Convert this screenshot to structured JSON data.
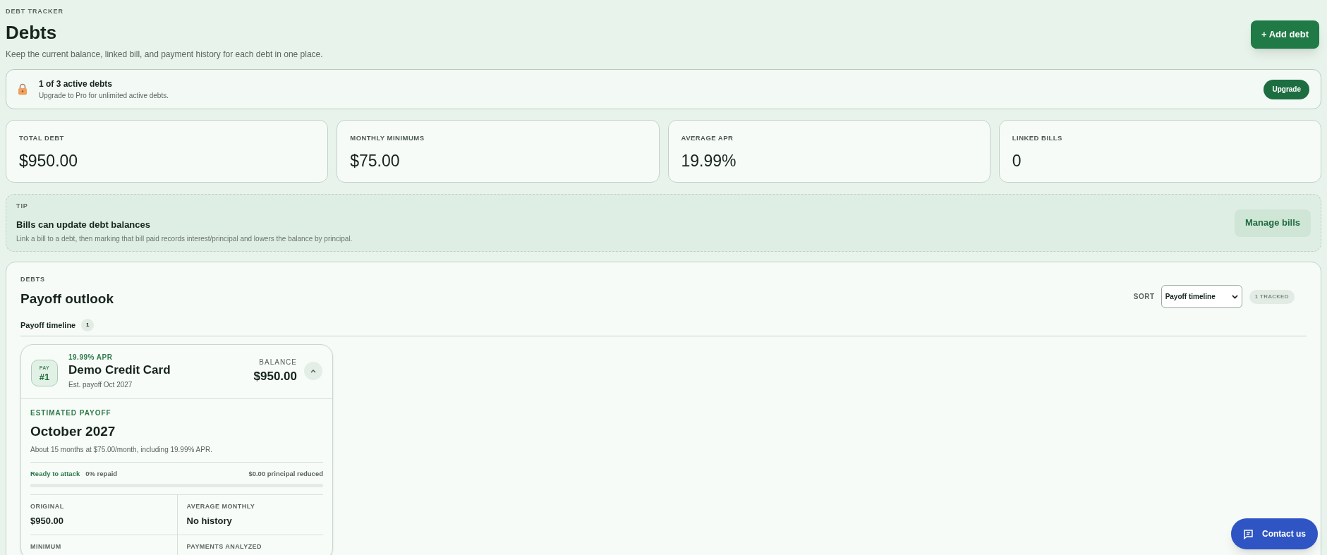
{
  "header": {
    "eyebrow": "DEBT TRACKER",
    "title": "Debts",
    "subtitle": "Keep the current balance, linked bill, and payment history for each debt in one place.",
    "add_button": "+ Add debt"
  },
  "limit_banner": {
    "title": "1 of 3 active debts",
    "text": "Upgrade to Pro for unlimited active debts.",
    "button": "Upgrade"
  },
  "stats": [
    {
      "label": "TOTAL DEBT",
      "value": "$950.00"
    },
    {
      "label": "MONTHLY MINIMUMS",
      "value": "$75.00"
    },
    {
      "label": "AVERAGE APR",
      "value": "19.99%"
    },
    {
      "label": "LINKED BILLS",
      "value": "0"
    }
  ],
  "tip": {
    "eyebrow": "TIP",
    "title": "Bills can update debt balances",
    "text": "Link a bill to a debt, then marking that bill paid records interest/principal and lowers the balance by principal.",
    "button": "Manage bills"
  },
  "debts_panel": {
    "eyebrow": "DEBTS",
    "title": "Payoff outlook",
    "sort_label": "SORT",
    "sort_value": "Payoff timeline",
    "tracked_badge": "1 TRACKED",
    "tabs": [
      {
        "label": "Payoff timeline",
        "count": "1",
        "selected": true
      }
    ],
    "cards": [
      {
        "apr": "19.99% APR",
        "rank_label": "PAY",
        "rank": "#1",
        "name": "Demo Credit Card",
        "est_payoff": "Est. payoff Oct 2027",
        "balance_label": "BALANCE",
        "balance": "$950.00",
        "expanded": true,
        "payoff_label": "ESTIMATED PAYOFF",
        "payoff_date": "October 2027",
        "payoff_text": "About 15 months at $75.00/month, including 19.99% APR.",
        "status": "Ready to attack",
        "repaid": "0% repaid",
        "reduced": "$0.00 principal reduced",
        "level": 0,
        "details": [
          {
            "label": "ORIGINAL",
            "value": "$950.00"
          },
          {
            "label": "AVERAGE MONTHLY",
            "value": "No history"
          },
          {
            "label": "MINIMUM"
          },
          {
            "label": "PAYMENTS ANALYZED"
          }
        ]
      }
    ]
  },
  "contact_button": "Contact us"
}
